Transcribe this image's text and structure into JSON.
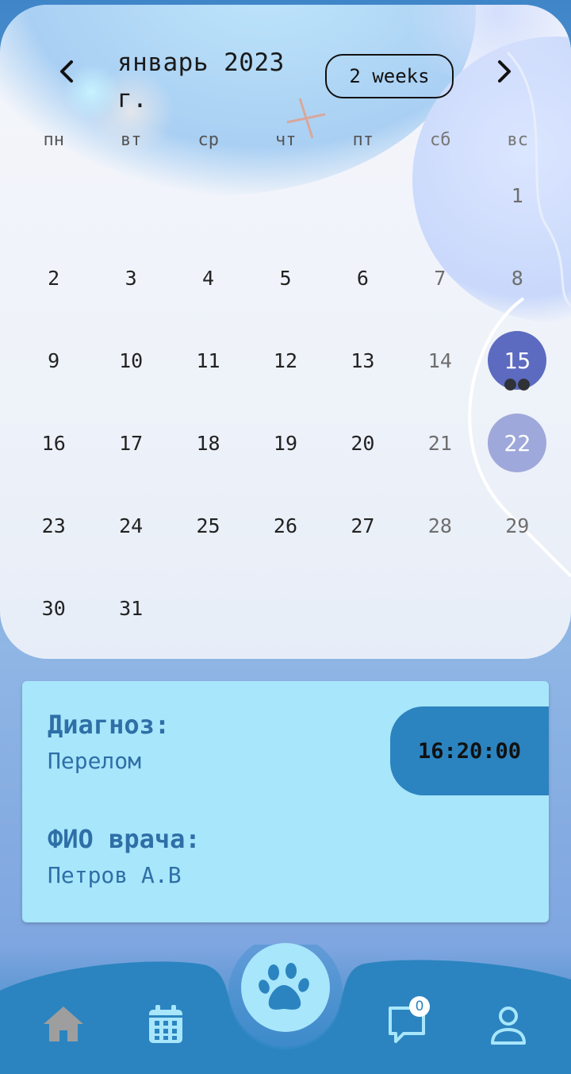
{
  "calendar": {
    "month_title": "январь 2023 г.",
    "format_button": "2 weeks",
    "weekdays": [
      "пн",
      "вт",
      "ср",
      "чт",
      "пт",
      "сб",
      "вс"
    ],
    "weeks": [
      [
        "",
        "",
        "",
        "",
        "",
        "",
        "1"
      ],
      [
        "2",
        "3",
        "4",
        "5",
        "6",
        "7",
        "8"
      ],
      [
        "9",
        "10",
        "11",
        "12",
        "13",
        "14",
        "15"
      ],
      [
        "16",
        "17",
        "18",
        "19",
        "20",
        "21",
        "22"
      ],
      [
        "23",
        "24",
        "25",
        "26",
        "27",
        "28",
        "29"
      ],
      [
        "30",
        "31",
        "",
        "",
        "",
        "",
        ""
      ]
    ],
    "selected_day": "15",
    "today_day": "22",
    "selected_event_markers": 2,
    "colors": {
      "selected": "#5c6bc0",
      "today": "#9fa8da",
      "marker": "#2f3338"
    }
  },
  "appointment": {
    "diagnosis_label": "Диагноз:",
    "diagnosis_value": "Перелом",
    "doctor_label": "ФИО врача:",
    "doctor_value": "Петров А.В",
    "time": "16:20:00",
    "colors": {
      "card": "#a8e6fb",
      "text": "#2f6fa7",
      "time_pill": "#2b84bf"
    }
  },
  "bottom_nav": {
    "items": [
      "home-icon",
      "calendar-icon",
      "paw-icon",
      "chat-icon",
      "profile-icon"
    ],
    "chat_badge": "0",
    "colors": {
      "bar": "#2b84bf",
      "home_icon": "#9e9e9e",
      "active_icon": "#a8e6fb"
    }
  }
}
